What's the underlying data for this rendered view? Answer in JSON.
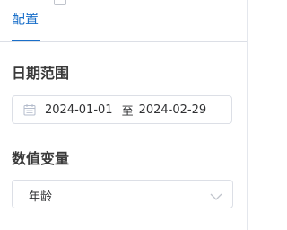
{
  "tabs": [
    {
      "label": "配置",
      "active": true
    }
  ],
  "sections": {
    "date_range": {
      "title": "日期范围",
      "start": "2024-01-01",
      "separator": "至",
      "end": "2024-02-29",
      "icon": "calendar-icon"
    },
    "numeric_variable": {
      "title": "数值变量",
      "selected": "年龄",
      "icon": "chevron-down-icon"
    }
  },
  "colors": {
    "accent": "#1a6fc9",
    "border": "#dcdfe6",
    "title": "#3a3a3a"
  }
}
